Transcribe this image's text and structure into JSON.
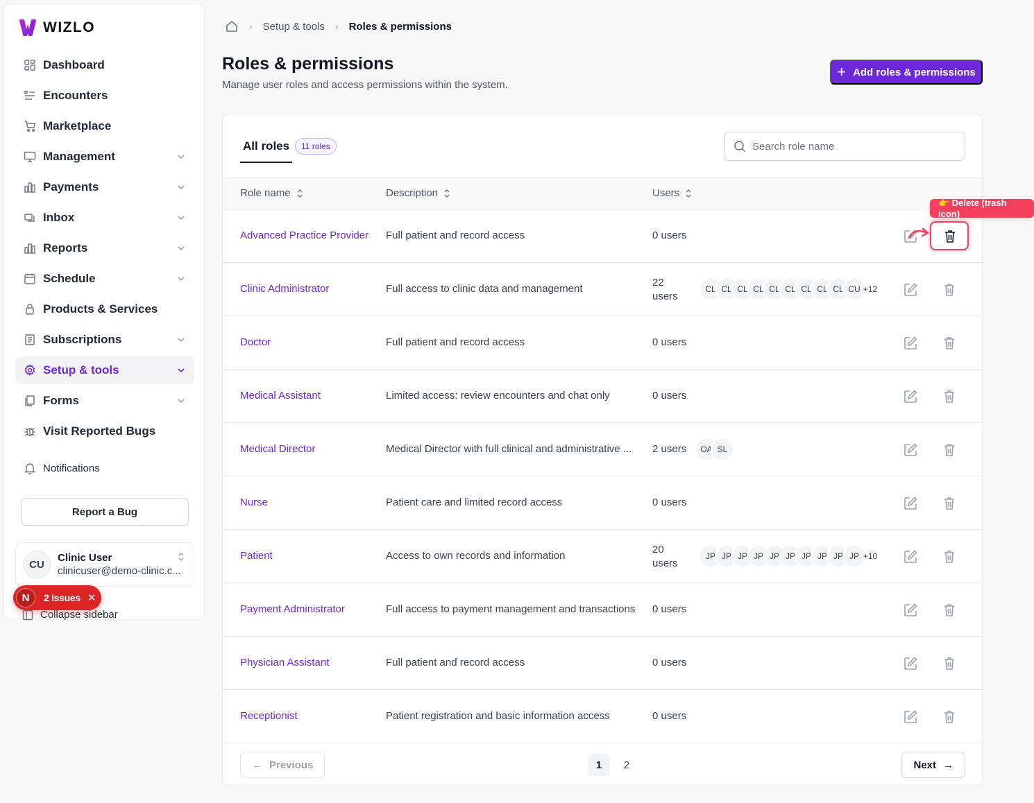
{
  "app": {
    "logo_text": "WIZLO",
    "brand_color": "#6d28d9"
  },
  "sidebar": {
    "items": [
      {
        "label": "Dashboard",
        "icon": "dashboard-icon",
        "chevron": false
      },
      {
        "label": "Encounters",
        "icon": "list-icon",
        "chevron": false
      },
      {
        "label": "Marketplace",
        "icon": "cart-icon",
        "chevron": false
      },
      {
        "label": "Management",
        "icon": "monitor-icon",
        "chevron": true
      },
      {
        "label": "Payments",
        "icon": "bar-chart-icon",
        "chevron": true
      },
      {
        "label": "Inbox",
        "icon": "inbox-icon",
        "chevron": true
      },
      {
        "label": "Reports",
        "icon": "reports-icon",
        "chevron": true
      },
      {
        "label": "Schedule",
        "icon": "calendar-icon",
        "chevron": true
      },
      {
        "label": "Products & Services",
        "icon": "lock-icon",
        "chevron": false
      },
      {
        "label": "Subscriptions",
        "icon": "receipt-icon",
        "chevron": true
      },
      {
        "label": "Setup & tools",
        "icon": "gear-icon",
        "chevron": true,
        "active": true
      },
      {
        "label": "Forms",
        "icon": "copy-icon",
        "chevron": true
      },
      {
        "label": "Visit Reported Bugs",
        "icon": "bug-icon",
        "chevron": false
      }
    ],
    "notifications_label": "Notifications",
    "report_bug_label": "Report a Bug",
    "user": {
      "initials": "CU",
      "name": "Clinic User",
      "email": "clinicuser@demo-clinic.c..."
    },
    "collapse_label": "Collapse sidebar",
    "issues": {
      "initial": "N",
      "label": "2 Issues"
    }
  },
  "breadcrumb": {
    "parent": "Setup & tools",
    "current": "Roles & permissions"
  },
  "header": {
    "title": "Roles & permissions",
    "subtitle": "Manage user roles and access permissions within the system.",
    "add_button_label": "Add roles & permissions"
  },
  "tabs": {
    "all_roles": "All roles",
    "count": "11 roles"
  },
  "search": {
    "placeholder": "Search role name"
  },
  "table": {
    "columns": [
      "Role name",
      "Description",
      "Users"
    ],
    "rows": [
      {
        "role": "Advanced Practice Provider",
        "description": "Full patient and record access",
        "users": "0 users",
        "avatars": [],
        "more": ""
      },
      {
        "role": "Clinic Administrator",
        "description": "Full access to clinic data and management",
        "users": "22 users",
        "avatars": [
          "CL",
          "CL",
          "CL",
          "CL",
          "CL",
          "CL",
          "CL",
          "CL",
          "CL",
          "CU"
        ],
        "more": "+12"
      },
      {
        "role": "Doctor",
        "description": "Full patient and record access",
        "users": "0 users",
        "avatars": [],
        "more": ""
      },
      {
        "role": "Medical Assistant",
        "description": "Limited access: review encounters and chat only",
        "users": "0 users",
        "avatars": [],
        "more": ""
      },
      {
        "role": "Medical Director",
        "description": "Medical Director with full clinical and administrative ...",
        "users": "2 users",
        "avatars": [
          "OA",
          "SL"
        ],
        "more": ""
      },
      {
        "role": "Nurse",
        "description": "Patient care and limited record access",
        "users": "0 users",
        "avatars": [],
        "more": ""
      },
      {
        "role": "Patient",
        "description": "Access to own records and information",
        "users": "20 users",
        "avatars": [
          "JP",
          "JP",
          "JP",
          "JP",
          "JP",
          "JP",
          "JP",
          "JP",
          "JP",
          "JP"
        ],
        "more": "+10"
      },
      {
        "role": "Payment Administrator",
        "description": "Full access to payment management and transactions",
        "users": "0 users",
        "avatars": [],
        "more": ""
      },
      {
        "role": "Physician Assistant",
        "description": "Full patient and record access",
        "users": "0 users",
        "avatars": [],
        "more": ""
      },
      {
        "role": "Receptionist",
        "description": "Patient registration and basic information access",
        "users": "0 users",
        "avatars": [],
        "more": ""
      }
    ]
  },
  "annotation": {
    "label": "👉 Delete (trash icon)",
    "color": "#f43f5e"
  },
  "pagination": {
    "previous": "Previous",
    "next": "Next",
    "pages": [
      "1",
      "2"
    ],
    "current": "1"
  }
}
